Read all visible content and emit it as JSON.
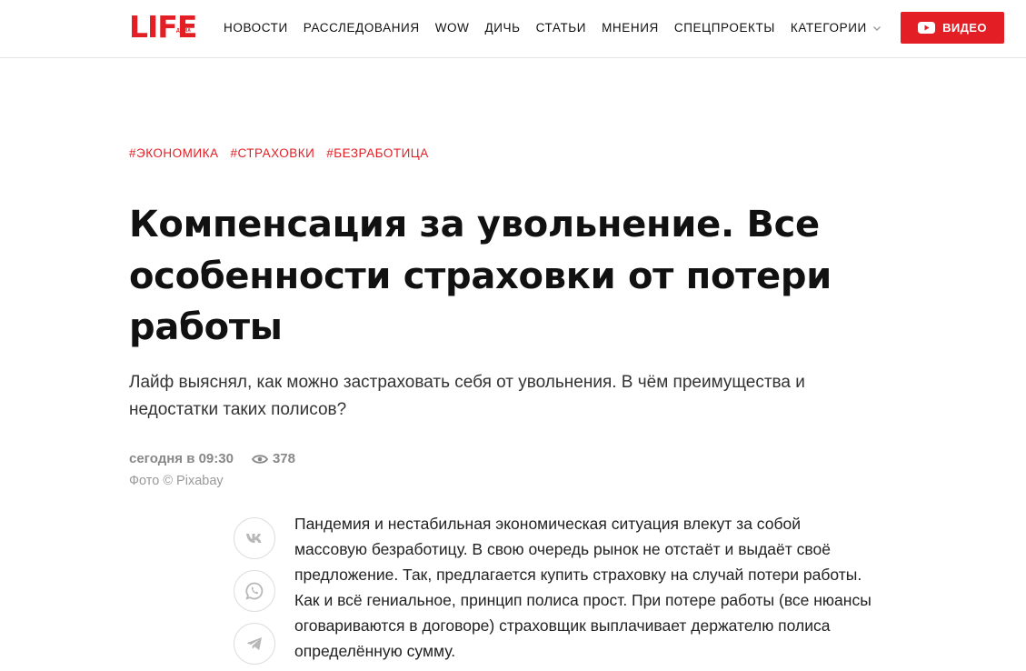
{
  "header": {
    "logo_text": "LIFE",
    "logo_sub": "ДОМА",
    "nav": [
      "НОВОСТИ",
      "РАССЛЕДОВАНИЯ",
      "WOW",
      "ДИЧЬ",
      "СТАТЬИ",
      "МНЕНИЯ",
      "СПЕЦПРОЕКТЫ"
    ],
    "categories_label": "КАТЕГОРИИ",
    "video_label": "ВИДЕО"
  },
  "article": {
    "tags": [
      "#ЭКОНОМИКА",
      "#СТРАХОВКИ",
      "#БЕЗРАБОТИЦА"
    ],
    "title": "Компенсация за увольнение. Все особенности страховки от потери работы",
    "lead": "Лайф выяснял, как можно застраховать себя от увольнения. В чём преимущества и недостатки таких полисов?",
    "date": "сегодня в 09:30",
    "views": "378",
    "photo_credit": "Фото © Pixabay",
    "body": "Пандемия и нестабильная экономическая ситуация влекут за собой массовую безработицу. В свою очередь рынок не отстаёт и выдаёт своё предложение. Так, предлагается купить страховку на случай потери работы. Как и всё гениальное, принцип полиса прост. При потере работы (все нюансы оговариваются в договоре) страховщик выплачивает держателю полиса определённую сумму."
  },
  "share": {
    "buttons": [
      "vk-icon",
      "whatsapp-icon",
      "telegram-icon"
    ]
  },
  "colors": {
    "brand_red": "#e31e24",
    "meta_gray": "#888888"
  }
}
